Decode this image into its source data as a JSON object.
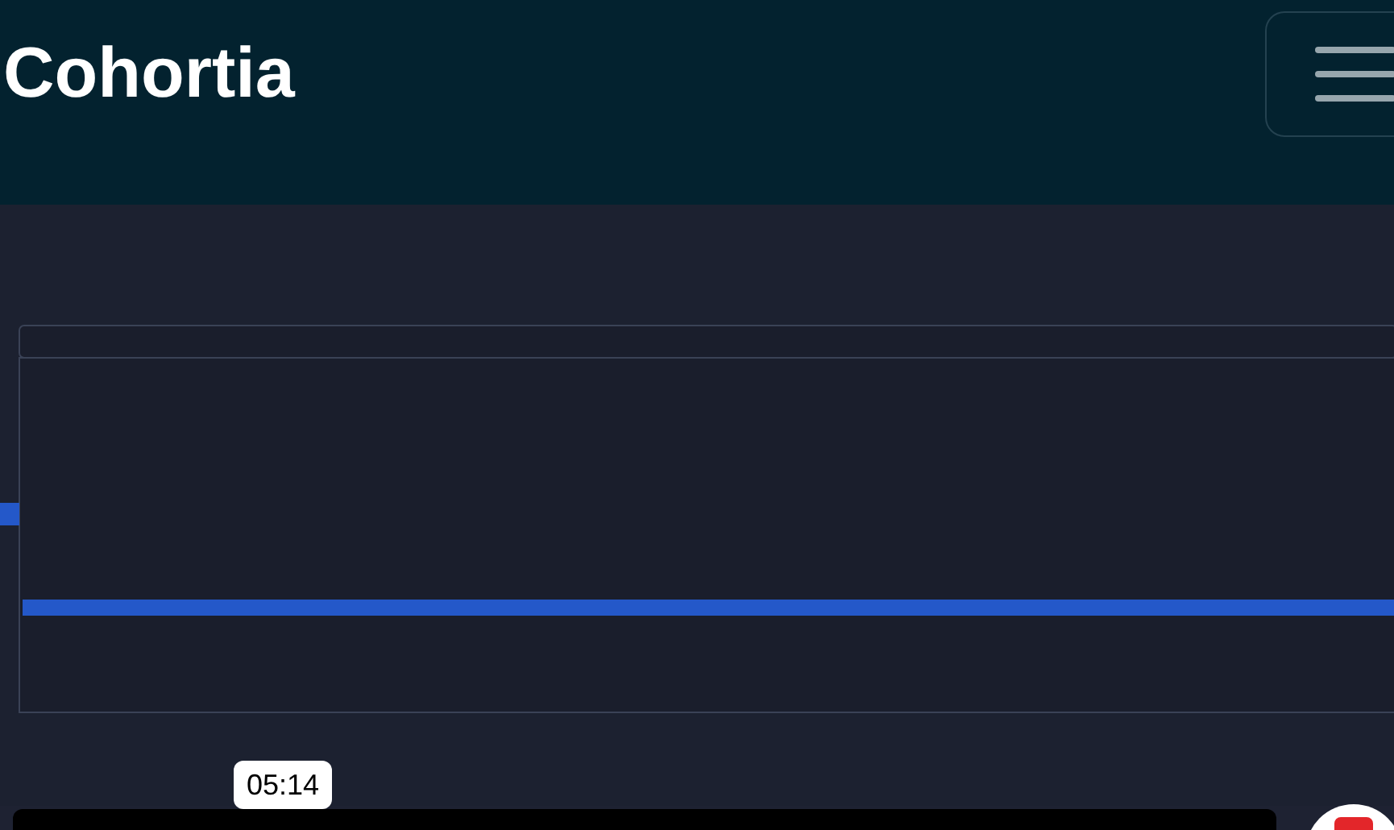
{
  "header": {
    "logo": "Cohortia"
  },
  "video": {
    "seek_tooltip": "05:14"
  }
}
